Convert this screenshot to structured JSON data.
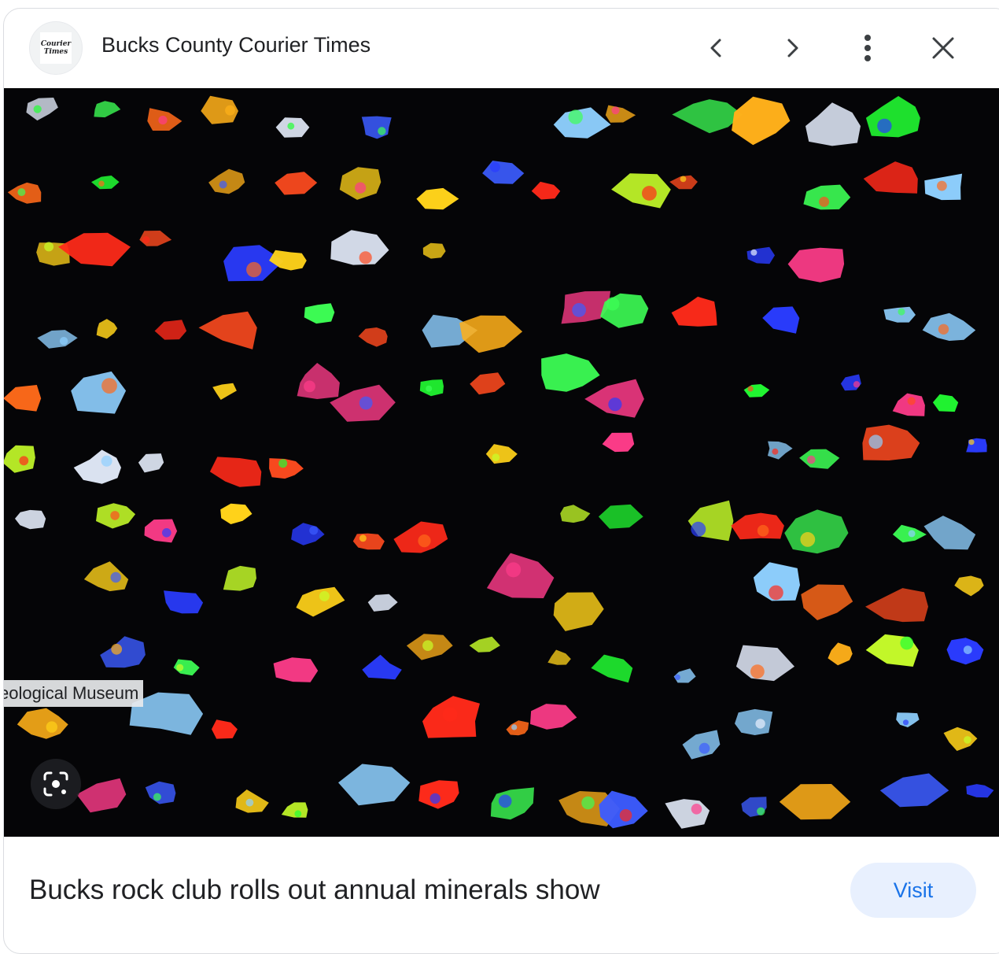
{
  "header": {
    "source_name": "Bucks County Courier Times",
    "logo_line1": "Courier",
    "logo_line2": "Times",
    "icons": {
      "previous": "chevron-left-icon",
      "next": "chevron-right-icon",
      "more": "more-vert-icon",
      "close": "close-icon"
    }
  },
  "image": {
    "caption_overlay": "eological Museum",
    "lens_icon": "google-lens-icon"
  },
  "footer": {
    "article_title": "Bucks rock club rolls out annual minerals show",
    "visit_label": "Visit"
  },
  "colors": {
    "text": "#202124",
    "visit_bg": "#e8f0fe",
    "visit_text": "#1a73e8",
    "image_bg": "#050507"
  }
}
